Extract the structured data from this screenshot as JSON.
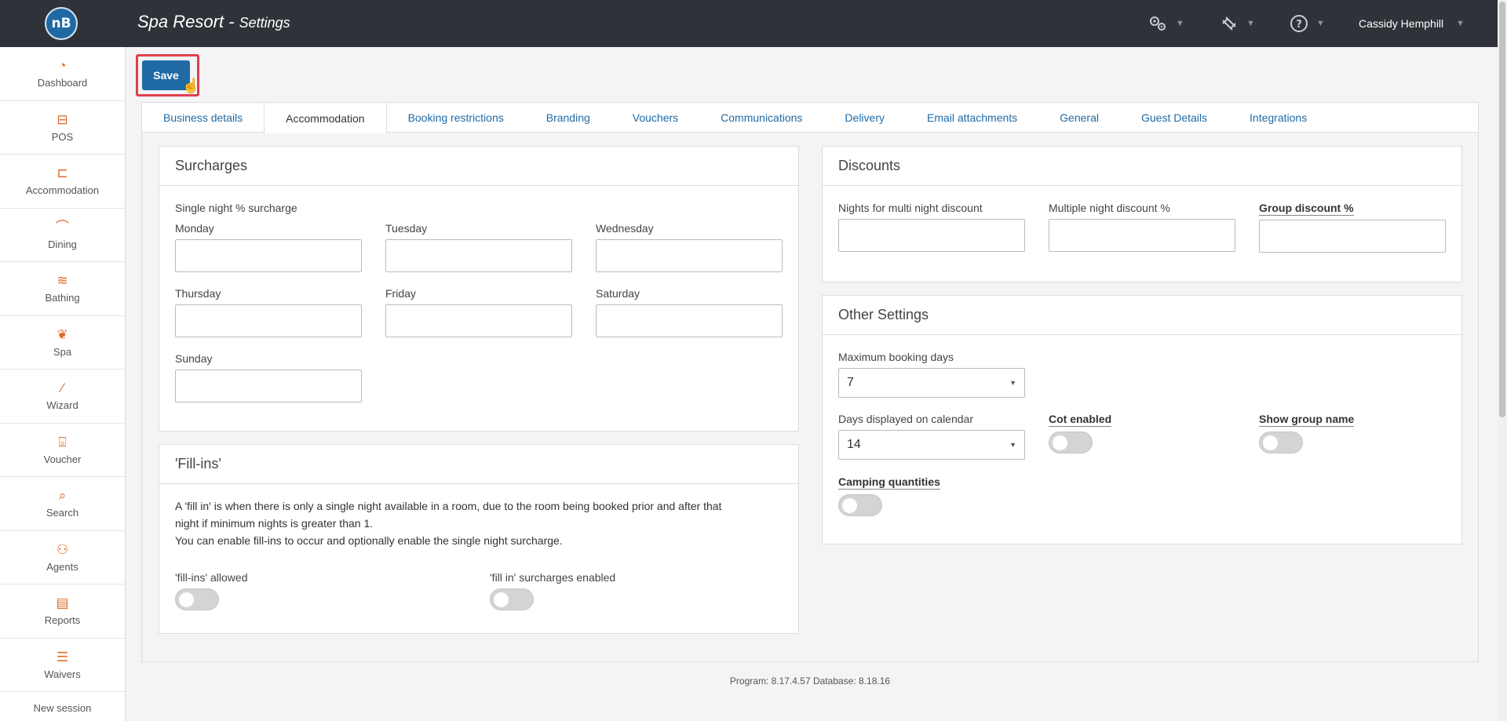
{
  "app": {
    "logo_text": "nB",
    "title": "Spa Resort - ",
    "subtitle": "Settings",
    "user": "Cassidy Hemphill",
    "icons": [
      "gears-icon",
      "plugin-icon",
      "help-icon"
    ]
  },
  "sidebar": {
    "items": [
      {
        "label": "Dashboard",
        "icon": "dashboard-icon"
      },
      {
        "label": "POS",
        "icon": "pos-icon"
      },
      {
        "label": "Accommodation",
        "icon": "bed-icon"
      },
      {
        "label": "Dining",
        "icon": "dining-icon"
      },
      {
        "label": "Bathing",
        "icon": "bathing-icon"
      },
      {
        "label": "Spa",
        "icon": "lotus-icon"
      },
      {
        "label": "Wizard",
        "icon": "wand-icon"
      },
      {
        "label": "Voucher",
        "icon": "gift-icon"
      },
      {
        "label": "Search",
        "icon": "search-icon"
      },
      {
        "label": "Agents",
        "icon": "agents-icon"
      },
      {
        "label": "Reports",
        "icon": "reports-icon"
      },
      {
        "label": "Waivers",
        "icon": "waivers-icon"
      }
    ],
    "footer": "New session"
  },
  "toolbar": {
    "save_label": "Save"
  },
  "tabs": [
    {
      "label": "Business details"
    },
    {
      "label": "Accommodation"
    },
    {
      "label": "Booking restrictions"
    },
    {
      "label": "Branding"
    },
    {
      "label": "Vouchers"
    },
    {
      "label": "Communications"
    },
    {
      "label": "Delivery"
    },
    {
      "label": "Email attachments"
    },
    {
      "label": "General"
    },
    {
      "label": "Guest Details"
    },
    {
      "label": "Integrations"
    }
  ],
  "active_tab": "Accommodation",
  "surcharges": {
    "title": "Surcharges",
    "heading": "Single night % surcharge",
    "days": {
      "monday": "Monday",
      "tuesday": "Tuesday",
      "wednesday": "Wednesday",
      "thursday": "Thursday",
      "friday": "Friday",
      "saturday": "Saturday",
      "sunday": "Sunday"
    }
  },
  "fillins": {
    "title": "'Fill-ins'",
    "text1": "A 'fill in' is when there is only a single night available in a room, due to the room being booked prior and after that",
    "text2": "night if minimum nights is greater than 1.",
    "text3": "You can enable fill-ins to occur and optionally enable the single night surcharge.",
    "allowed_label": "'fill-ins' allowed",
    "surcharges_label": "'fill in' surcharges enabled",
    "allowed": false,
    "surcharges_enabled": false
  },
  "discounts": {
    "title": "Discounts",
    "multi_nights_label": "Nights for multi night discount",
    "multi_pct_label": "Multiple night discount %",
    "group_label": "Group discount %"
  },
  "other": {
    "title": "Other Settings",
    "max_booking_label": "Maximum booking days",
    "max_booking_value": "7",
    "days_displayed_label": "Days displayed on calendar",
    "days_displayed_value": "14",
    "cot_label": "Cot enabled",
    "show_group_label": "Show group name",
    "camping_label": "Camping quantities",
    "cot_enabled": false,
    "show_group_name": false,
    "camping_quantities": false
  },
  "footer": {
    "version": "Program: 8.17.4.57 Database: 8.18.16"
  },
  "colors": {
    "accent": "#1f6aa5",
    "topbar": "#2f3238",
    "icon": "#e06a2a",
    "highlight": "#e0404b"
  }
}
